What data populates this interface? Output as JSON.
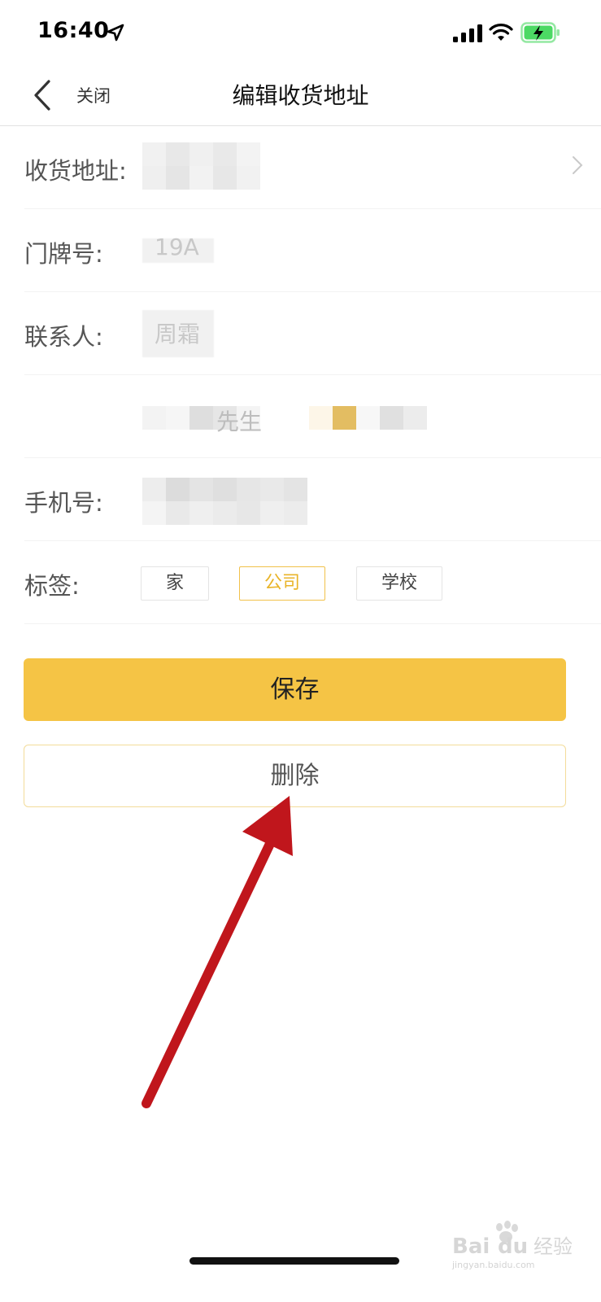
{
  "status_bar": {
    "time": "16:40",
    "location_icon": "location-arrow-icon",
    "signal_icon": "cellular-signal-icon",
    "wifi_icon": "wifi-icon",
    "battery_icon": "battery-charging-icon",
    "battery_color": "#4cd964"
  },
  "nav": {
    "back_icon": "chevron-left-icon",
    "close_label": "关闭",
    "title": "编辑收货地址"
  },
  "form": {
    "address": {
      "label": "收货地址:",
      "chevron_icon": "chevron-right-icon"
    },
    "door_number": {
      "label": "门牌号:",
      "value": "19A"
    },
    "contact": {
      "label": "联系人:",
      "value": "周霜"
    },
    "gender_row_text": "先生",
    "phone": {
      "label": "手机号:"
    },
    "tags": {
      "label": "标签:",
      "options": [
        "家",
        "公司",
        "学校"
      ],
      "selected": "公司"
    }
  },
  "actions": {
    "save_label": "保存",
    "delete_label": "删除"
  },
  "theme": {
    "accent": "#f5c445",
    "accent_text": "#e9b429",
    "annotation_arrow": "#c0161c"
  },
  "watermark": {
    "brand": "Bai du 经验",
    "url": "jingyan.baidu.com"
  }
}
